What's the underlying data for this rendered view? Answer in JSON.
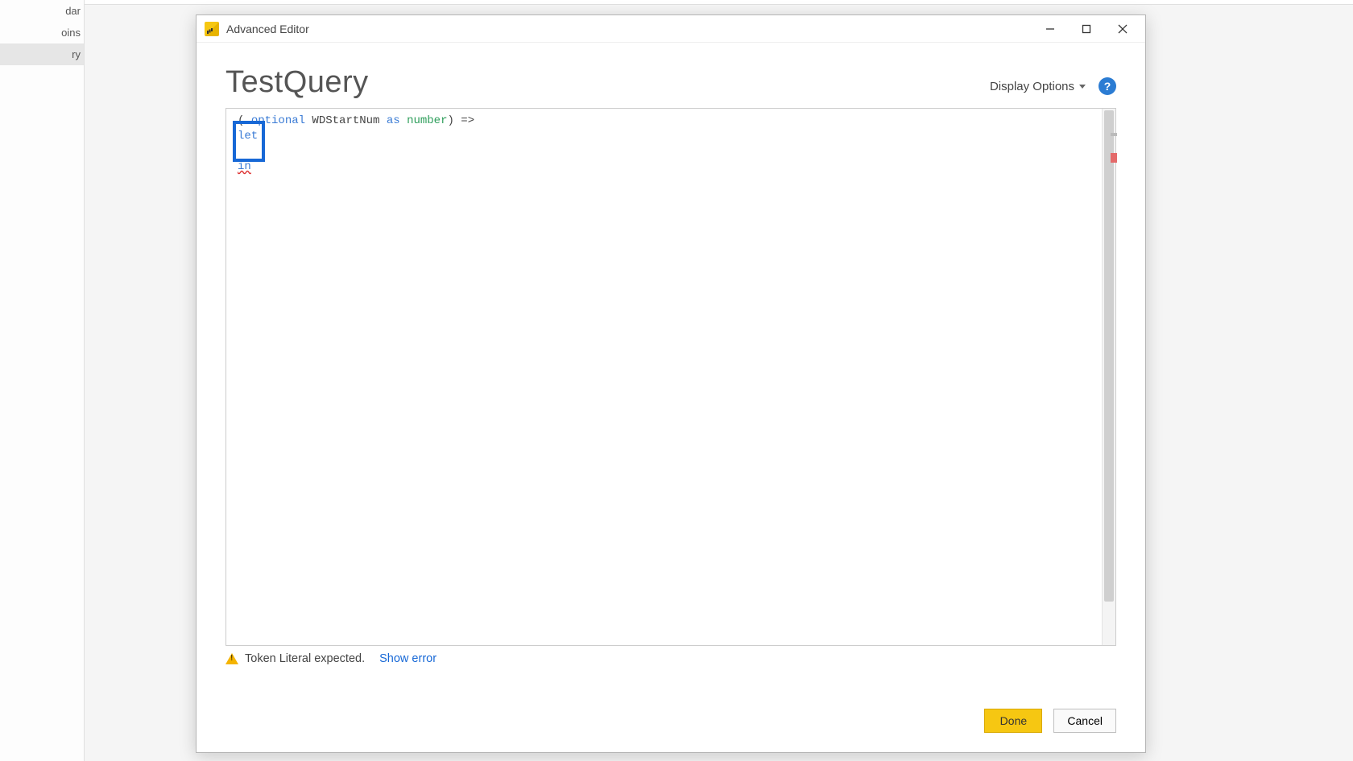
{
  "window": {
    "title": "Advanced Editor"
  },
  "sidebar": {
    "items": [
      "dar",
      "oins",
      "ry"
    ],
    "selected_index": 2
  },
  "header": {
    "query_name": "TestQuery",
    "display_options_label": "Display Options",
    "help_tooltip": "?"
  },
  "code": {
    "line1_prefix": "( ",
    "line1_kw_optional": "optional",
    "line1_ident": " WDStartNum ",
    "line1_kw_as": "as",
    "line1_space": " ",
    "line1_type": "number",
    "line1_suffix": ") =>",
    "line2_kw": "let",
    "line3": "",
    "line4_kw": "in"
  },
  "status": {
    "message": "Token Literal expected.",
    "show_error_label": "Show error"
  },
  "buttons": {
    "done": "Done",
    "cancel": "Cancel"
  }
}
